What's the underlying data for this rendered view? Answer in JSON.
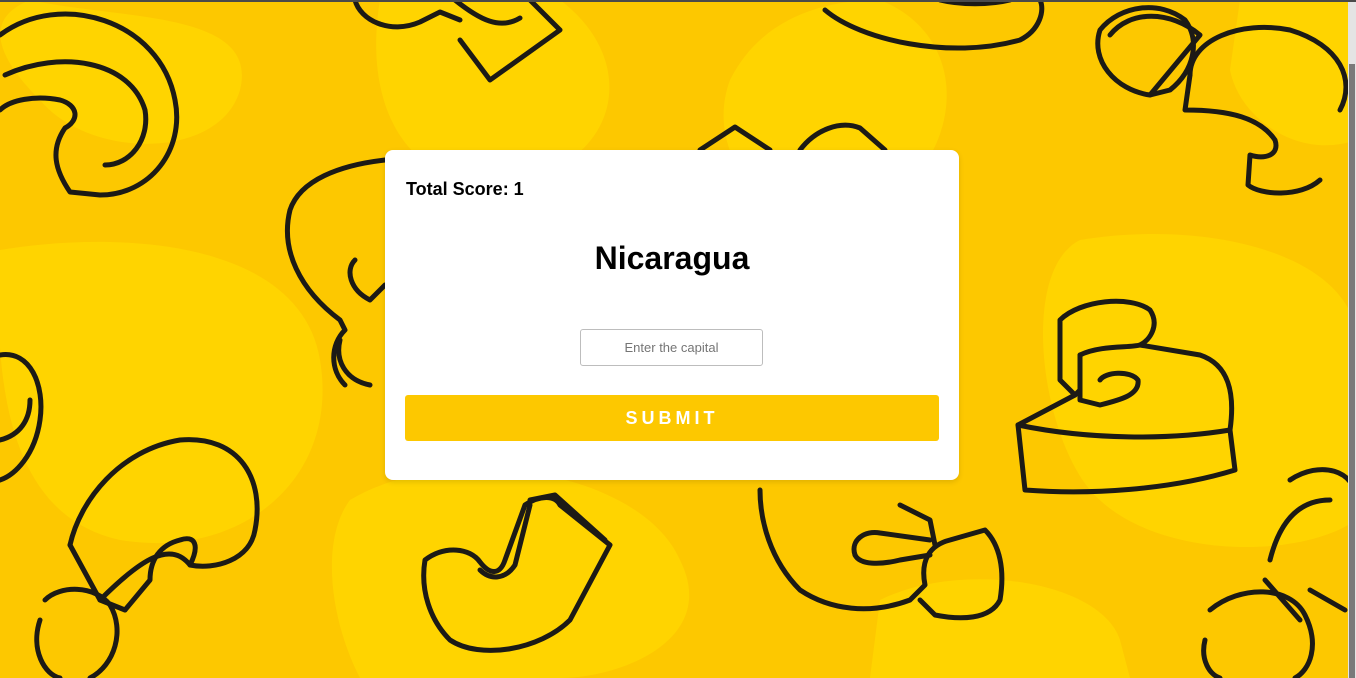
{
  "quiz": {
    "score_label": "Total Score: 1",
    "country": "Nicaragua",
    "capital_placeholder": "Enter the capital",
    "capital_value": "",
    "submit_label": "SUBMIT"
  },
  "theme": {
    "background": "#fdc800",
    "blob_light": "#ffd400",
    "card": "#ffffff",
    "button": "#fdc800",
    "button_text": "#ffffff",
    "outline": "#1c1a16"
  }
}
